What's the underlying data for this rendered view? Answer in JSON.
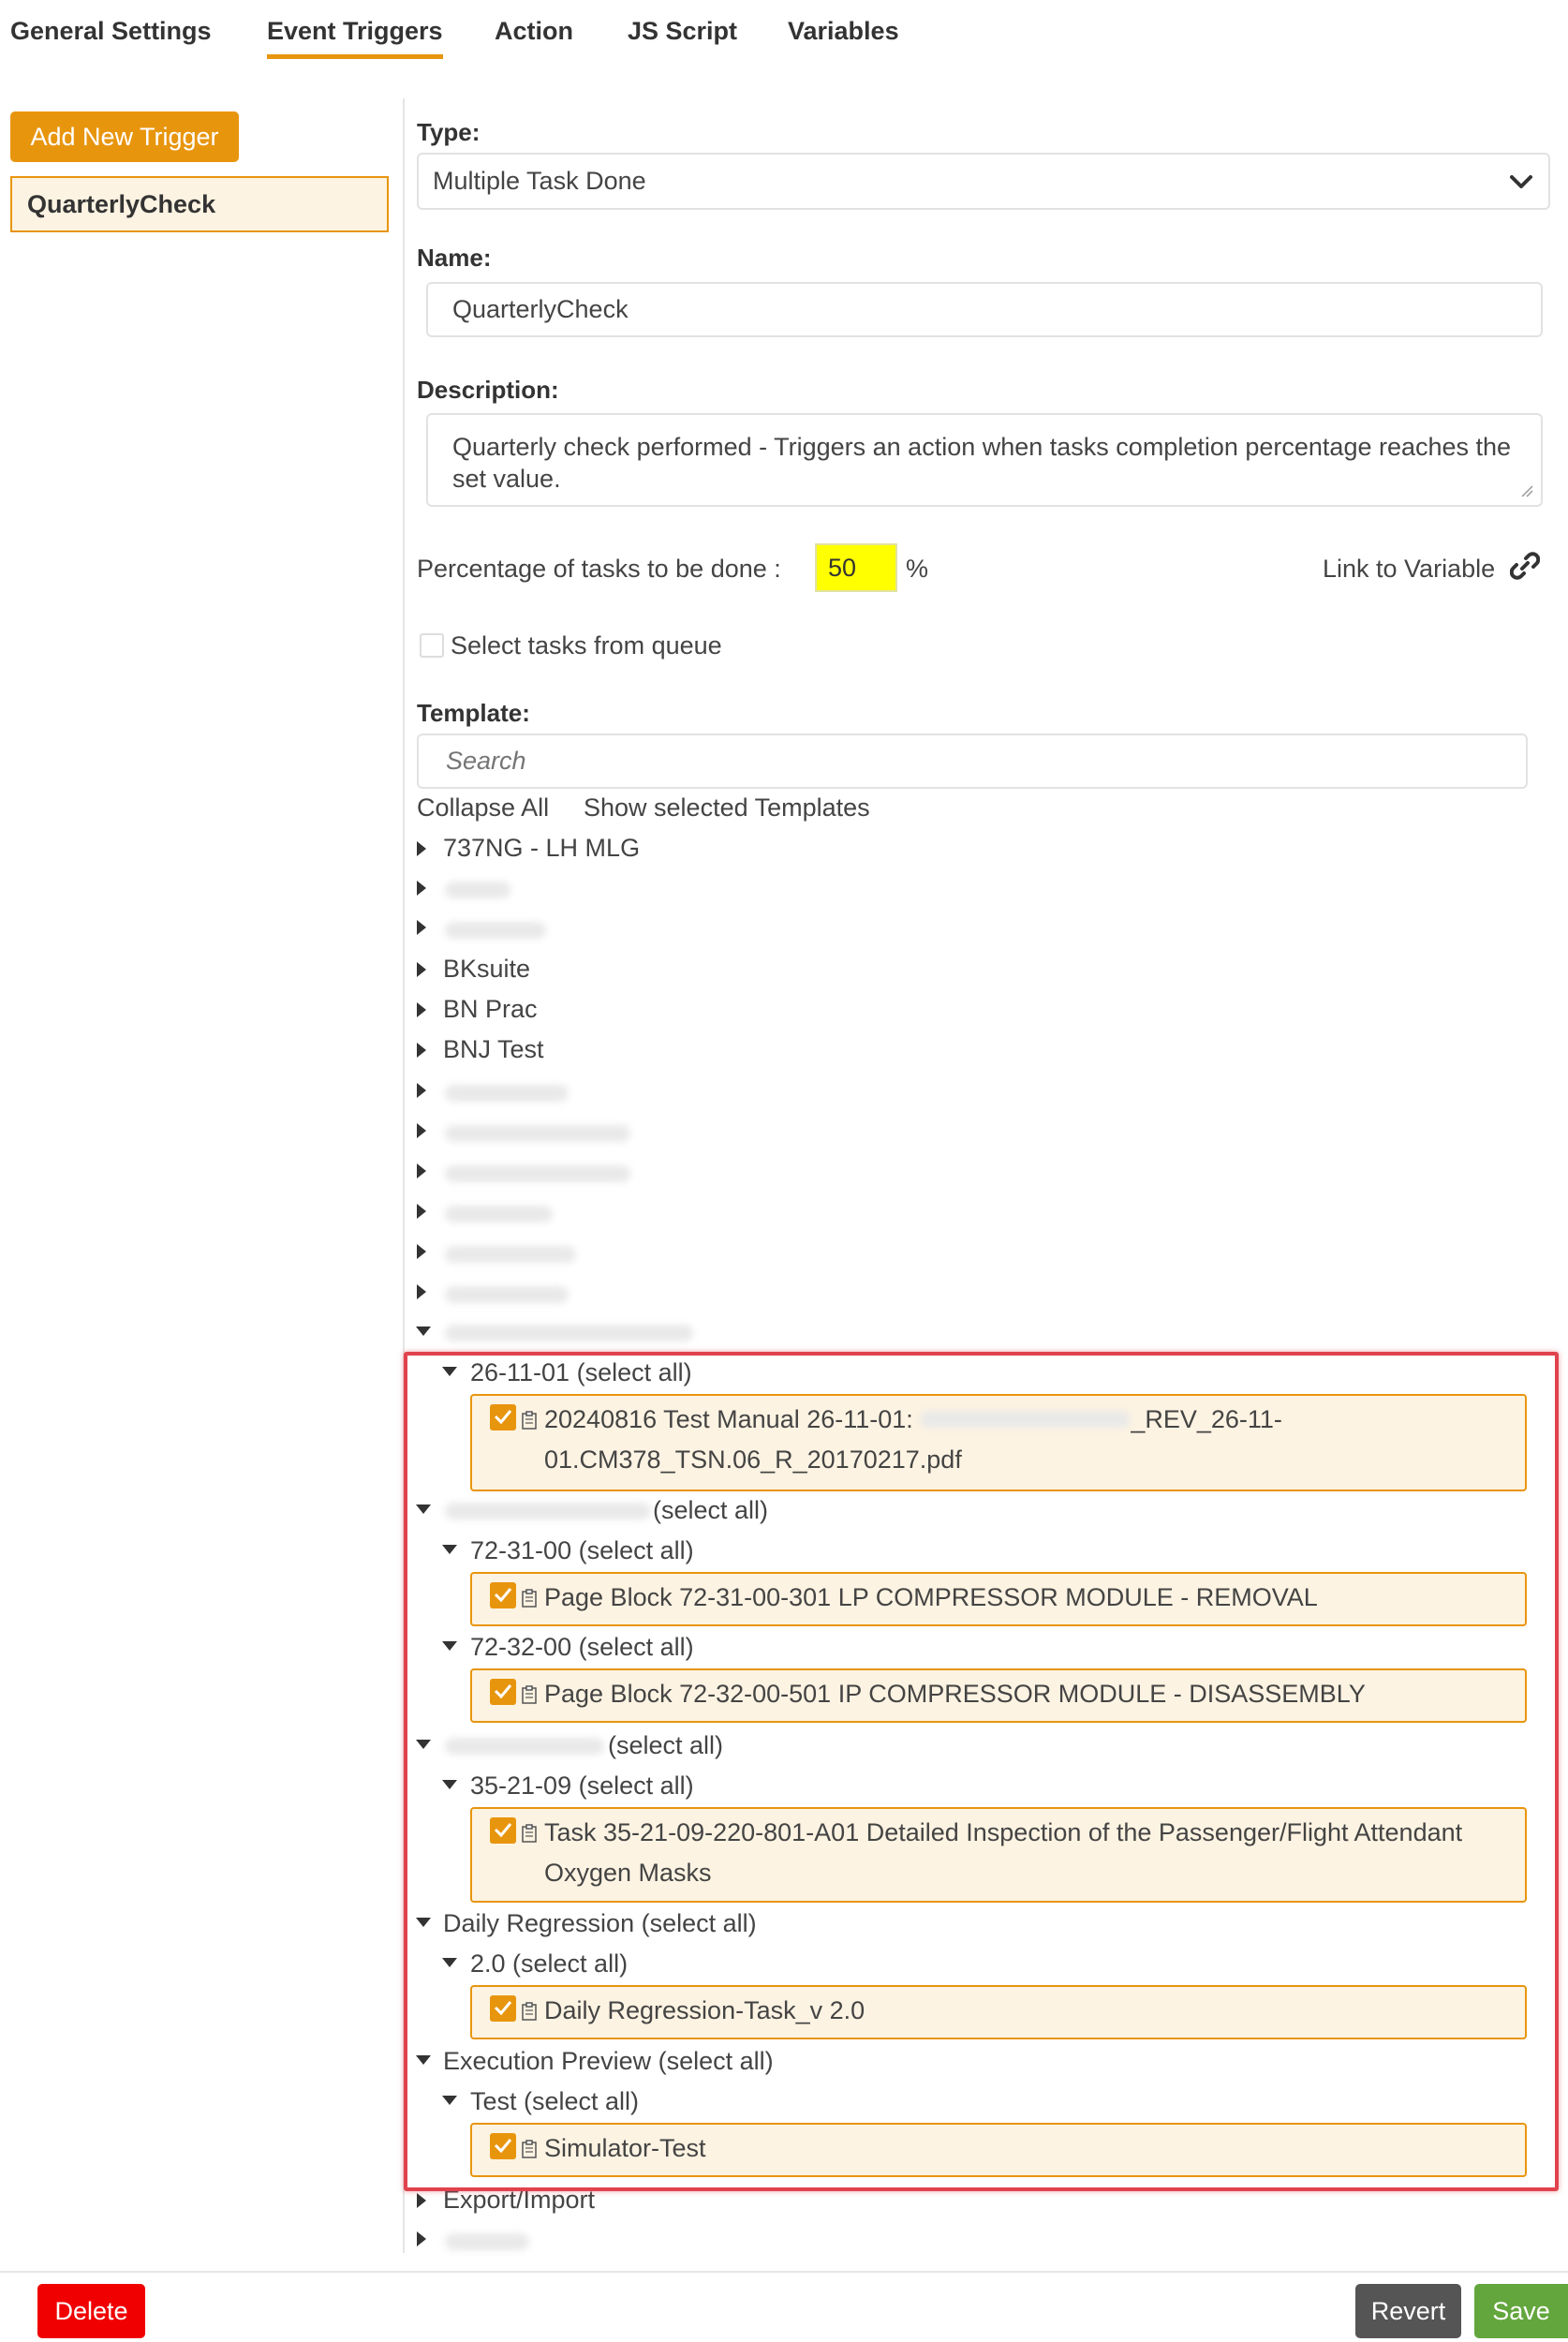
{
  "tabs": [
    {
      "label": "General Settings",
      "active": false
    },
    {
      "label": "Event Triggers",
      "active": true
    },
    {
      "label": "Action",
      "active": false
    },
    {
      "label": "JS Script",
      "active": false
    },
    {
      "label": "Variables",
      "active": false
    }
  ],
  "sidebar": {
    "add_button": "Add New Trigger",
    "triggers": [
      "QuarterlyCheck"
    ]
  },
  "form": {
    "type_label": "Type:",
    "type_value": "Multiple Task Done",
    "name_label": "Name:",
    "name_value": "QuarterlyCheck",
    "description_label": "Description:",
    "description_value": "Quarterly check performed - Triggers an action when tasks completion percentage reaches the set value.",
    "percentage_label": "Percentage of tasks to be done :",
    "percentage_value": "50",
    "percentage_unit": "%",
    "link_variable": "Link to Variable",
    "queue_checkbox_label": "Select tasks from queue",
    "queue_checked": false,
    "template_label": "Template:",
    "search_placeholder": "Search",
    "collapse_all": "Collapse All",
    "show_selected": "Show selected Templates"
  },
  "tree": {
    "t1": "737NG - LH MLG",
    "t4": "BKsuite",
    "t5": "BN Prac",
    "t6": "BNJ Test",
    "g1_child": "26-11-01 (select all)",
    "leaf1_a": "20240816 Test Manual 26-11-01:",
    "leaf1_b": "_REV_26-11-",
    "leaf1_c": "01.CM378_TSN.06_R_20170217.pdf",
    "select_all": "(select all)",
    "g2_child1": "72-31-00 (select all)",
    "leaf2": "Page Block 72-31-00-301 LP COMPRESSOR MODULE - REMOVAL",
    "g2_child2": "72-32-00 (select all)",
    "leaf3": "Page Block 72-32-00-501 IP COMPRESSOR MODULE - DISASSEMBLY",
    "g3_child": "35-21-09 (select all)",
    "leaf4_a": "Task 35-21-09-220-801-A01 Detailed Inspection of the Passenger/Flight Attendant",
    "leaf4_b": "Oxygen Masks",
    "daily": "Daily Regression (select all)",
    "daily_child": "2.0 (select all)",
    "leaf5": "Daily Regression-Task_v 2.0",
    "exec": "Execution Preview (select all)",
    "exec_child": "Test (select all)",
    "leaf6": "Simulator-Test",
    "export": "Export/Import"
  },
  "footer": {
    "delete": "Delete",
    "revert": "Revert",
    "save": "Save"
  },
  "colors": {
    "accent": "#e8950e",
    "highlight_border": "#e0434d",
    "delete": "#f00000",
    "revert": "#555555",
    "save": "#63a63d"
  }
}
